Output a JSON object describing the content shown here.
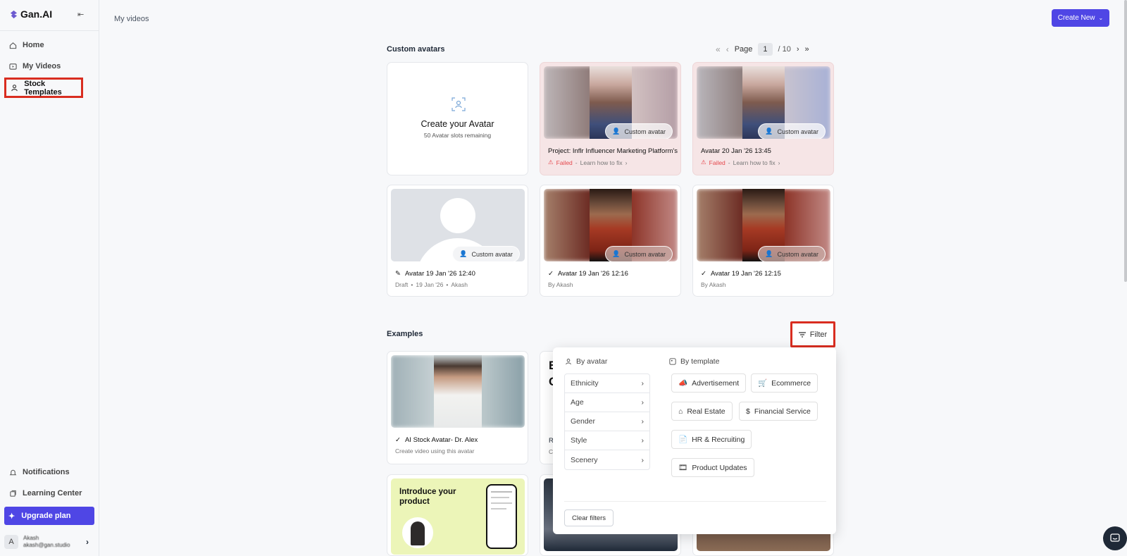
{
  "app": {
    "name": "Gan.AI"
  },
  "sidebar": {
    "items": [
      {
        "label": "Home",
        "icon": "home-icon"
      },
      {
        "label": "My Videos",
        "icon": "video-icon"
      },
      {
        "label": "Stock Templates",
        "icon": "user-icon"
      }
    ],
    "bottom": [
      {
        "label": "Notifications",
        "icon": "bell-icon"
      },
      {
        "label": "Learning Center",
        "icon": "book-icon"
      }
    ],
    "upgrade": "Upgrade plan",
    "user": {
      "initial": "A",
      "name": "Akash",
      "email": "akash@gan.studio"
    }
  },
  "header": {
    "title": "My videos",
    "create_new": "Create New"
  },
  "custom_avatars": {
    "title": "Custom avatars",
    "pager": {
      "label": "Page",
      "current": "1",
      "total": "/ 10"
    },
    "create_card": {
      "title": "Create your Avatar",
      "subtitle": "50 Avatar slots remaining"
    },
    "cards": [
      {
        "badge": "Custom avatar",
        "title": "Project: Inflr Influencer Marketing Platform's",
        "status": "Failed",
        "status_link": "Learn how to fix"
      },
      {
        "badge": "Custom avatar",
        "title": "Avatar 20 Jan '26 13:45",
        "status": "Failed",
        "status_link": "Learn how to fix"
      },
      {
        "badge": "Custom avatar",
        "title": "Avatar 19 Jan '26 12:40",
        "sub_status": "Draft",
        "sub_date": "19 Jan '26",
        "sub_author": "Akash"
      },
      {
        "badge": "Custom avatar",
        "title": "Avatar 19 Jan '26 12:16",
        "sub": "By Akash"
      },
      {
        "badge": "Custom avatar",
        "title": "Avatar 19 Jan '26 12:15",
        "sub": "By Akash"
      }
    ]
  },
  "examples": {
    "title": "Examples",
    "filter_label": "Filter",
    "cards": [
      {
        "title": "AI Stock Avatar- Dr. Alex",
        "subtitle": "Create video using this avatar"
      },
      {
        "title": "R",
        "subtitle": "C",
        "heading_partial": "E",
        "heading_partial2": "C"
      },
      {
        "promo_line1": "Introduce your",
        "promo_line2": "product"
      }
    ]
  },
  "filter_panel": {
    "by_avatar": "By avatar",
    "by_template": "By template",
    "avatar_filters": [
      "Ethnicity",
      "Age",
      "Gender",
      "Style",
      "Scenery"
    ],
    "template_filters": [
      "Advertisement",
      "Ecommerce",
      "Real Estate",
      "Financial Service",
      "HR & Recruiting",
      "Product Updates"
    ],
    "clear": "Clear filters"
  },
  "colors": {
    "accent": "#4f46e5",
    "highlight": "#d92d20",
    "failed": "#e5484d"
  }
}
